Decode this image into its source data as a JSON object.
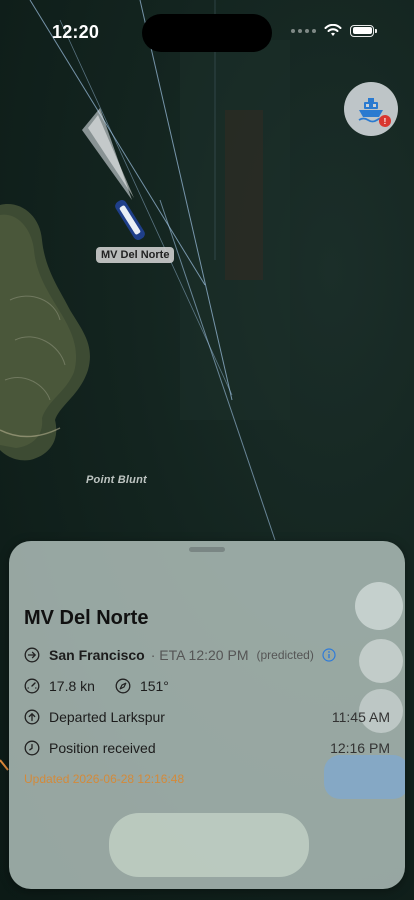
{
  "status_bar": {
    "time": "12:20"
  },
  "map": {
    "vessel_label": "MV Del Norte",
    "place_label": "Point Blunt"
  },
  "ferry_button": {
    "icon": "ferry-icon",
    "badge": "!"
  },
  "sheet": {
    "vessel_name": "MV Del Norte",
    "destination": "San Francisco",
    "eta": "· ETA 12:20 PM",
    "eta_note": "(predicted)",
    "speed": "17.8 kn",
    "heading": "151°",
    "departed_label": "Departed Larkspur",
    "departed_time": "11:45 AM",
    "position_label": "Position received",
    "position_time": "12:16 PM",
    "updated": "Updated 2026-06-28 12:16:48"
  },
  "colors": {
    "accent_blue": "#2f7bd8",
    "updated_orange": "#d38a3a",
    "badge_red": "#d9362f"
  }
}
